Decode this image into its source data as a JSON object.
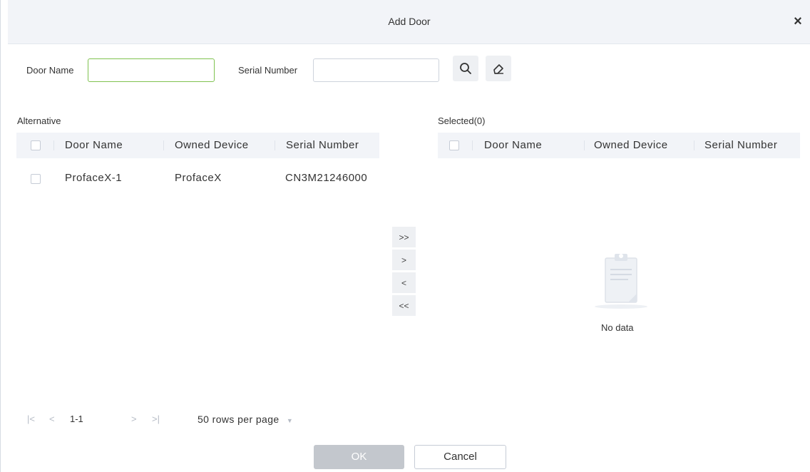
{
  "dialog": {
    "title": "Add Door"
  },
  "search": {
    "door_name_label": "Door Name",
    "door_name_value": "",
    "serial_label": "Serial Number",
    "serial_value": ""
  },
  "alternative": {
    "label": "Alternative",
    "columns": [
      "Door Name",
      "Owned Device",
      "Serial Number"
    ],
    "rows": [
      {
        "door_name": "ProfaceX-1",
        "owned_device": "ProfaceX",
        "serial_number": "CN3M21246000"
      }
    ]
  },
  "selected": {
    "label": "Selected(0)",
    "columns": [
      "Door Name",
      "Owned Device",
      "Serial Number"
    ],
    "empty_text": "No data"
  },
  "transfer": {
    "all_right": ">>",
    "right": ">",
    "left": "<",
    "all_left": "<<"
  },
  "pagination": {
    "first": "|<",
    "prev": "<",
    "range": "1-1",
    "next": ">",
    "last": ">|",
    "rows_per_page": "50 rows per page"
  },
  "footer": {
    "ok_label": "OK",
    "cancel_label": "Cancel"
  },
  "colors": {
    "accent_green": "#7fc24f",
    "header_bg": "#f2f4f8",
    "ok_disabled": "#c3c7cd"
  }
}
